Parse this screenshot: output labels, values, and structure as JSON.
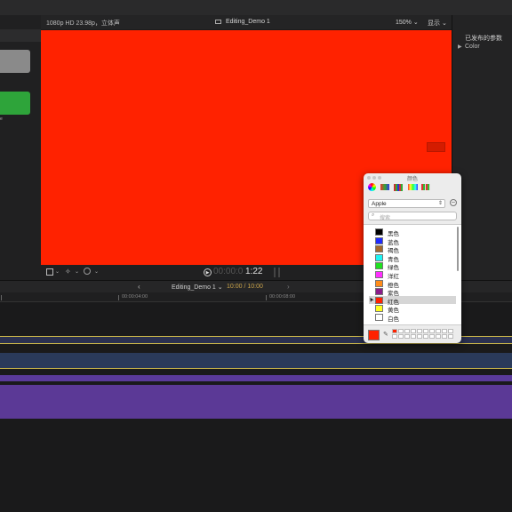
{
  "topbar": {},
  "viewer_header": {
    "format": "1080p HD 23.98p，立体声",
    "project_title": "Editing_Demo 1",
    "zoom": "150%",
    "display_menu": "显示"
  },
  "inspector": {
    "title": "已发布的参数",
    "item_label": "Color"
  },
  "transport": {
    "timecode_dim": "00:00:0",
    "timecode": "1:22"
  },
  "timeline_header": {
    "project": "Editing_Demo 1",
    "duration": "10:00 / 10:00"
  },
  "ruler": {
    "tick1": "00:00:04:00",
    "tick2": "00:00:08:00"
  },
  "color_panel": {
    "title": "颜色",
    "palette": "Apple",
    "search_placeholder": "搜索",
    "items": [
      {
        "label": "黑色",
        "color": "#000000"
      },
      {
        "label": "蓝色",
        "color": "#1f2bff"
      },
      {
        "label": "褐色",
        "color": "#a5692c"
      },
      {
        "label": "青色",
        "color": "#1ff4f4"
      },
      {
        "label": "绿色",
        "color": "#1fe01f"
      },
      {
        "label": "洋红",
        "color": "#ff2fff"
      },
      {
        "label": "橙色",
        "color": "#ff8c1a"
      },
      {
        "label": "紫色",
        "color": "#8a1d8a"
      },
      {
        "label": "红色",
        "color": "#ff2200"
      },
      {
        "label": "黄色",
        "color": "#ffff1f"
      },
      {
        "label": "白色",
        "color": "#ffffff"
      }
    ],
    "selected_index": 8,
    "current_color": "#ff2200"
  }
}
